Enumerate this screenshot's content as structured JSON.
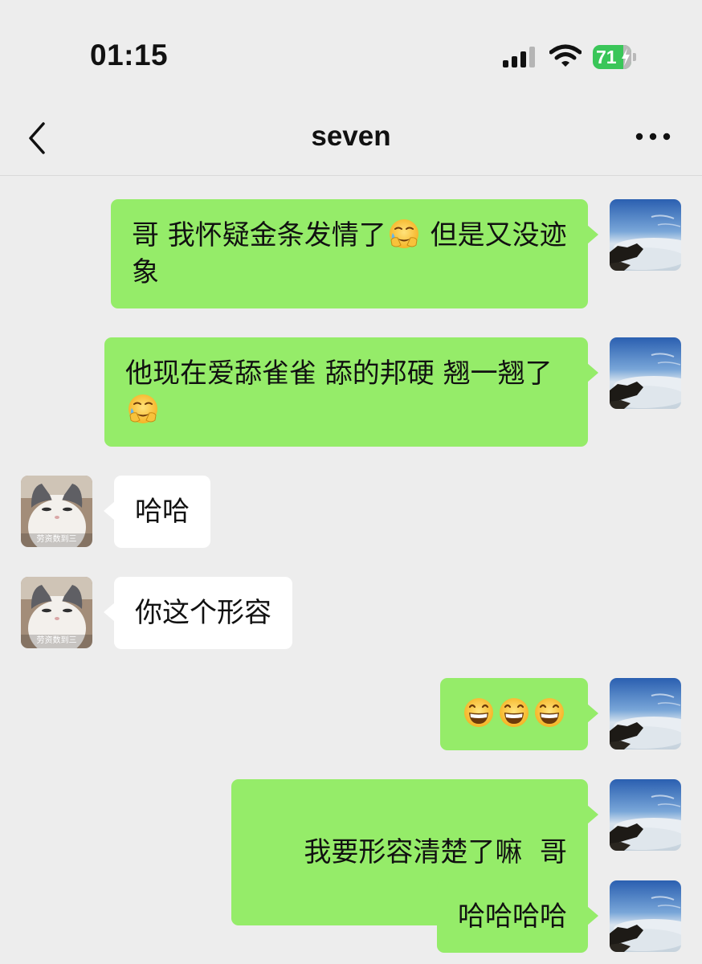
{
  "status_bar": {
    "time": "01:15",
    "battery": "71",
    "icons": [
      "cellular-signal-icon",
      "wifi-icon",
      "battery-charging-icon"
    ]
  },
  "nav": {
    "title": "seven",
    "icons": [
      "chevron-left-icon",
      "more-dots-icon"
    ]
  },
  "contact_avatar_caption": "劳资数到三",
  "colors": {
    "background": "#ededed",
    "sent_bubble": "#95ec69",
    "received_bubble": "#ffffff",
    "battery_green": "#3ac659"
  },
  "messages": [
    {
      "sender": "me",
      "segments": [
        "哥 我怀疑金条发情了",
        "但是又没迹象"
      ],
      "emoji": "face-holding-back-tears-icon"
    },
    {
      "sender": "me",
      "segments": [
        "他现在爱舔雀雀 舔的邦硬 翘一翘了"
      ],
      "emoji": "face-holding-back-tears-icon"
    },
    {
      "sender": "other",
      "text": "哈哈"
    },
    {
      "sender": "other",
      "text": "你这个形容"
    },
    {
      "sender": "me",
      "emoji_only": [
        "grinning-face-icon",
        "grinning-face-icon",
        "grinning-face-icon"
      ]
    },
    {
      "sender": "me",
      "text": "我要形容清楚了嘛  哥"
    },
    {
      "sender": "me",
      "text": "哈哈哈哈"
    }
  ]
}
